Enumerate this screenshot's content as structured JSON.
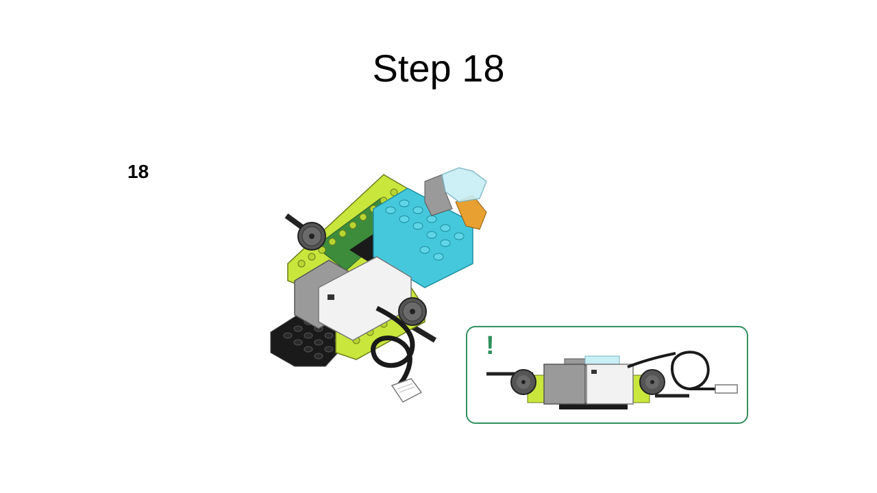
{
  "slide": {
    "title": "Step 18",
    "step_number": "18"
  },
  "callout": {
    "icon": "exclamation-icon",
    "symbol": "!",
    "accent_color": "#2f8f5b"
  },
  "colors": {
    "lime": "#c8e63c",
    "light_blue": "#45c8dc",
    "green": "#4caa3c",
    "black": "#1a1a1a",
    "grey": "#9a9a9a",
    "white_motor": "#f2f2f2"
  }
}
